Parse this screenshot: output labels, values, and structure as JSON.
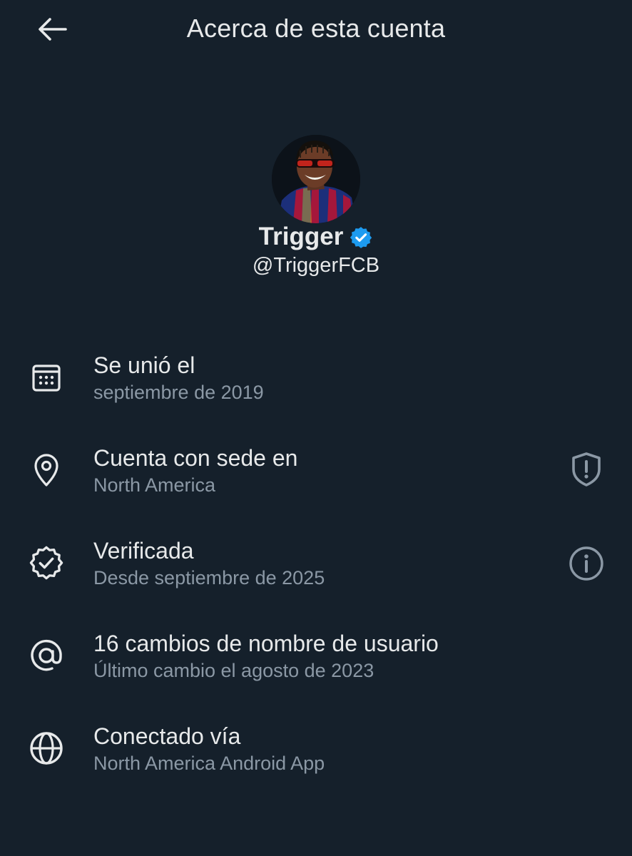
{
  "header": {
    "title": "Acerca de esta cuenta",
    "back_icon": "arrow-left-icon"
  },
  "profile": {
    "display_name": "Trigger",
    "verified_icon": "verified-badge-icon",
    "handle": "@TriggerFCB"
  },
  "info": {
    "joined": {
      "icon": "calendar-icon",
      "title": "Se unió el",
      "subtitle": "septiembre de 2019"
    },
    "location": {
      "icon": "location-pin-icon",
      "title": "Cuenta con sede en",
      "subtitle": "North America",
      "action_icon": "shield-alert-icon"
    },
    "verified": {
      "icon": "verified-check-icon",
      "title": "Verificada",
      "subtitle": "Desde septiembre de 2025",
      "action_icon": "info-icon"
    },
    "username_changes": {
      "icon": "at-sign-icon",
      "title": "16 cambios de nombre de usuario",
      "subtitle": "Último cambio el agosto de 2023"
    },
    "connected": {
      "icon": "globe-icon",
      "title": "Conectado vía",
      "subtitle": "North America Android App"
    }
  },
  "colors": {
    "background": "#15202b",
    "text_primary": "#e7e9ea",
    "text_secondary": "#8b98a5",
    "verified_blue": "#1d9bf0"
  }
}
